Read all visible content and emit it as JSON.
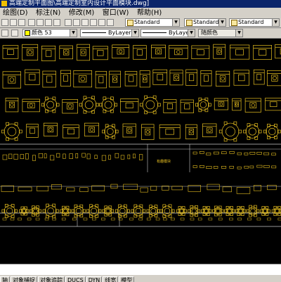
{
  "window": {
    "title": "高端定制平面图\\高端定制室内设计平面模块.dwg]"
  },
  "menu": [
    "绘图(D)",
    "标注(N)",
    "修改(M)",
    "窗口(W)",
    "帮助(H)"
  ],
  "styles": {
    "text_style": "Standard",
    "dim_style": "Standard",
    "table_style": "Standard"
  },
  "properties": {
    "color": "颜色 53",
    "linetype": "ByLayer",
    "lineweight": "ByLayer",
    "plotstyle": "随颜色"
  },
  "drawing_labels": {
    "center_note": "有趣模块"
  },
  "status_tabs": [
    "轴",
    "对象捕捉",
    "对象追踪",
    "DUCS",
    "DYN",
    "线宽",
    "模型"
  ],
  "colors": {
    "canvas_bg": "#000000",
    "block_yellow": "#e8c020",
    "grid_white": "#c8c8c8",
    "title_blue": "#0a246a"
  }
}
